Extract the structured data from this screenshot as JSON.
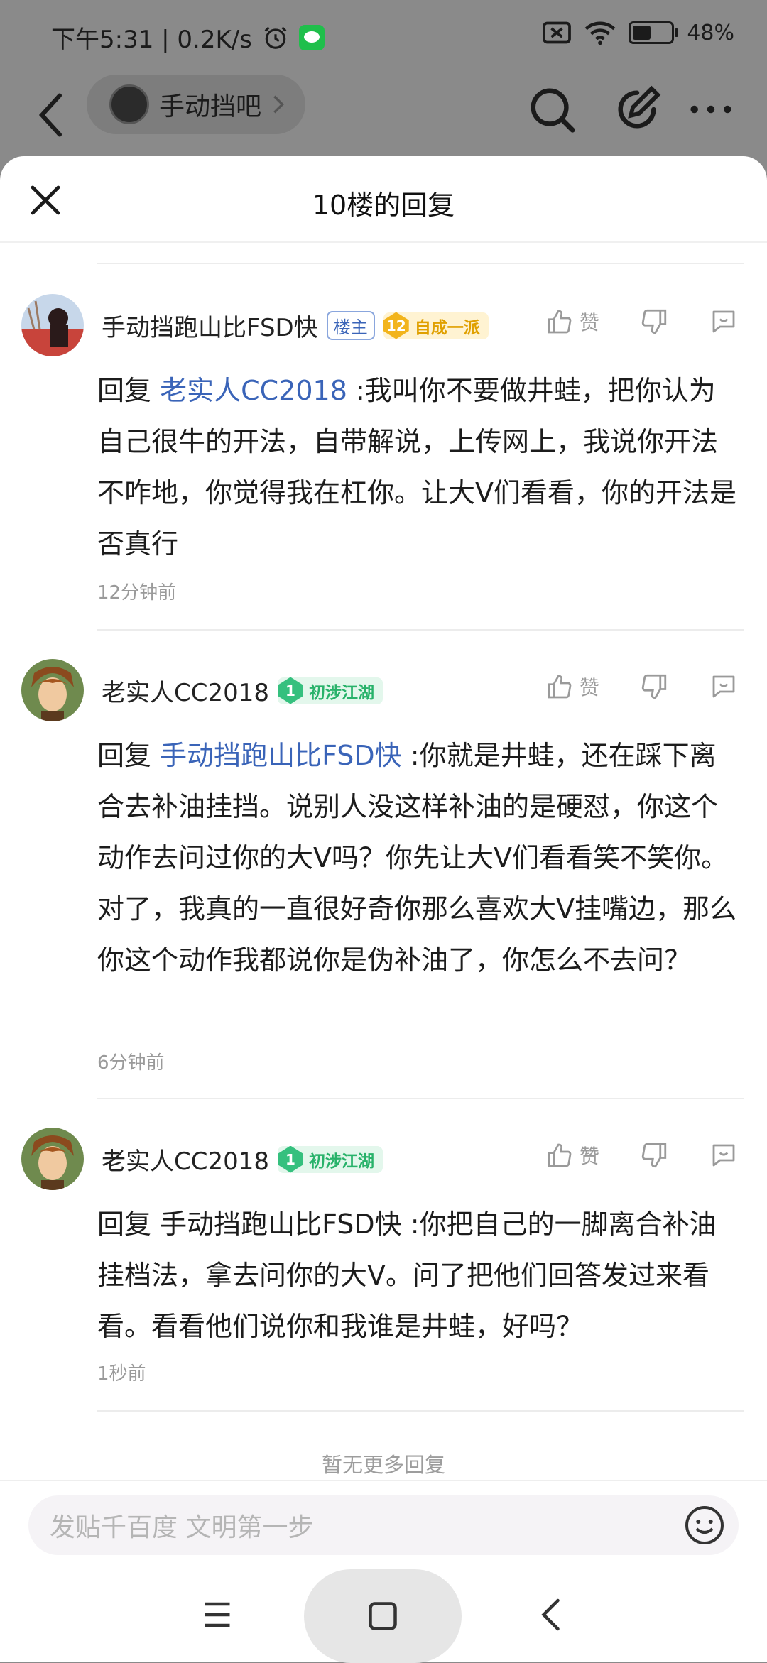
{
  "status": {
    "time_speed": "下午5:31 | 0.2K/s",
    "battery": "48%",
    "battery_level": 0.48
  },
  "nav": {
    "forum_name": "手动挡吧"
  },
  "sheet": {
    "title": "10楼的回复"
  },
  "comments": [
    {
      "author": "手动挡跑山比FSD快",
      "owner_tag": "楼主",
      "level": "12",
      "level_title": "自成一派",
      "like_label": "赞",
      "reply_prefix": "回复",
      "mention": "老实人CC2018",
      "text": " :我叫你不要做井蛙，把你认为自己很牛的开法，自带解说，上传网上，我说你开法不咋地，你觉得我在杠你。让大V们看看，你的开法是否真行",
      "time": "12分钟前"
    },
    {
      "author": "老实人CC2018",
      "level": "1",
      "level_title": "初涉江湖",
      "like_label": "赞",
      "reply_prefix": "回复",
      "mention": "手动挡跑山比FSD快",
      "text": " :你就是井蛙，还在踩下离合去补油挂挡。说别人没这样补油的是硬怼，你这个动作去问过你的大V吗？你先让大V们看看笑不笑你。对了，我真的一直很好奇你那么喜欢大V挂嘴边，那么你这个动作我都说你是伪补油了，你怎么不去问？",
      "time": "6分钟前"
    },
    {
      "author": "老实人CC2018",
      "level": "1",
      "level_title": "初涉江湖",
      "like_label": "赞",
      "reply_prefix": "回复",
      "mention": "手动挡跑山比FSD快",
      "text": " :你把自己的一脚离合补油挂档法，拿去问你的大V。问了把他们回答发过来看看。看看他们说你和我谁是井蛙，好吗？",
      "time": "1秒前"
    }
  ],
  "footer": {
    "no_more": "暂无更多回复",
    "input_placeholder": "发贴千百度 文明第一步"
  },
  "colors": {
    "mention": "#3a64b8",
    "gold_badge": "#f2b41c",
    "green_badge": "#35c07e"
  }
}
